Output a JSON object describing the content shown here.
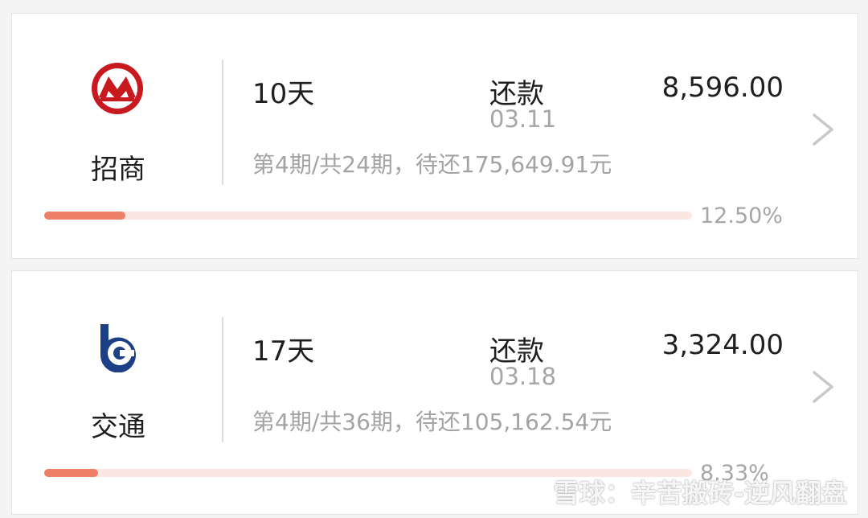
{
  "loans": [
    {
      "bank_name": "招商",
      "logo_icon": "cmb-bank-logo-icon",
      "days": "10天",
      "repay_label": "还款",
      "repay_date": "03.11",
      "amount": "8,596.00",
      "detail": "第4期/共24期，待还175,649.91元",
      "progress_label": "12.50%",
      "progress_value": 12.5
    },
    {
      "bank_name": "交通",
      "logo_icon": "bocom-bank-logo-icon",
      "days": "17天",
      "repay_label": "还款",
      "repay_date": "03.18",
      "amount": "3,324.00",
      "detail": "第4期/共36期，待还105,162.54元",
      "progress_label": "8.33%",
      "progress_value": 8.33
    }
  ],
  "watermark": {
    "text": "雪球：辛苦搬砖-逆风翻盘",
    "icon": "xueqiu-logo-icon"
  },
  "colors": {
    "progress_fill": "#ef7f66",
    "progress_track": "#fbe6e1",
    "cmb_red": "#c8191f",
    "bocom_blue": "#1c3f86"
  }
}
